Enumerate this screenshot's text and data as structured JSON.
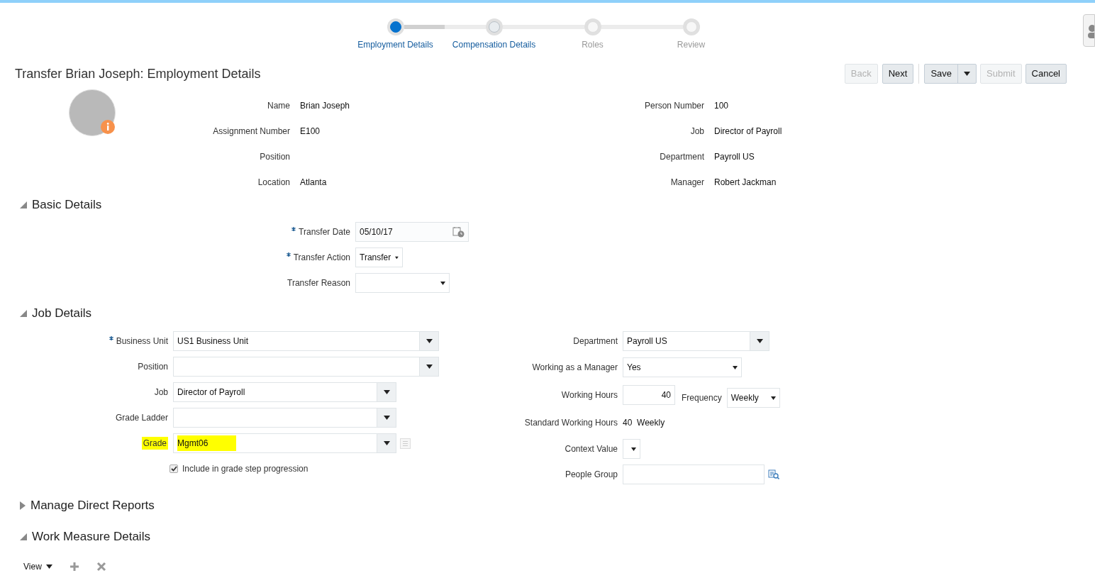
{
  "train": [
    {
      "label": "Employment Details",
      "selected": true,
      "visited": true
    },
    {
      "label": "Compensation Details",
      "selected": false,
      "visited": true
    },
    {
      "label": "Roles",
      "selected": false,
      "visited": false
    },
    {
      "label": "Review",
      "selected": false,
      "visited": false
    }
  ],
  "title": "Transfer Brian Joseph: Employment Details",
  "navigation_buttons": [
    {
      "label": "Back",
      "kind": "button",
      "disabled": true
    },
    {
      "label": "Next",
      "kind": "button",
      "disabled": false
    }
  ],
  "action_buttons": [
    {
      "label": "Save",
      "kind": "split",
      "disabled": false
    },
    {
      "label": "Submit",
      "kind": "button",
      "disabled": true
    },
    {
      "label": "Cancel",
      "kind": "button",
      "disabled": false
    }
  ],
  "person": {
    "left": [
      {
        "label": "Name",
        "value": "Brian Joseph"
      },
      {
        "label": "Assignment Number",
        "value": "E100"
      },
      {
        "label": "Position"
      },
      {
        "label": "Location",
        "value": "Atlanta"
      }
    ],
    "right": [
      {
        "label": "Person Number",
        "value": "100"
      },
      {
        "label": "Job",
        "value": "Director of Payroll"
      },
      {
        "label": "Department",
        "value": "Payroll US"
      },
      {
        "label": "Manager",
        "value": "Robert Jackman"
      }
    ]
  },
  "sections": [
    {
      "title": "Basic Details",
      "expanded": true,
      "kind": "form",
      "fields": [
        {
          "label": "Transfer Date",
          "kind": "date",
          "value": "05/10/17",
          "required": true
        },
        {
          "label": "Transfer Action",
          "kind": "choice",
          "value": "Transfer",
          "required": true
        },
        {
          "label": "Transfer Reason",
          "kind": "choice",
          "required": false
        }
      ]
    },
    {
      "title": "Job Details",
      "expanded": true,
      "kind": "two_column",
      "left": [
        {
          "label": "Business Unit",
          "kind": "lov",
          "value": "US1 Business Unit",
          "required": true,
          "highlighted": false,
          "detail_button": false
        },
        {
          "label": "Position",
          "kind": "lov",
          "required": false,
          "highlighted": false,
          "detail_button": false
        },
        {
          "label": "Job",
          "kind": "lov",
          "value": "Director of Payroll",
          "required": false,
          "highlighted": false,
          "detail_button": false
        },
        {
          "label": "Grade Ladder",
          "kind": "lov",
          "required": false,
          "highlighted": false,
          "detail_button": false
        },
        {
          "label": "Grade",
          "kind": "lov",
          "value": "Mgmt06",
          "required": false,
          "highlighted": true,
          "detail_button": true
        },
        {
          "label": "Include in grade step progression",
          "kind": "checkbox",
          "checked": true
        }
      ],
      "right": [
        {
          "label": "Department",
          "kind": "lov",
          "value": "Payroll US"
        },
        {
          "label": "Working as a Manager",
          "kind": "choice",
          "value": "Yes"
        },
        {
          "label": "Working Hours",
          "kind": "number",
          "value": "40",
          "extra": {
            "label": "Frequency",
            "value": "Weekly"
          }
        },
        {
          "label": "Standard Working Hours",
          "kind": "text",
          "value": "40  Weekly"
        },
        {
          "label": "Context Value",
          "kind": "choice"
        },
        {
          "label": "People Group",
          "kind": "search"
        }
      ]
    },
    {
      "title": "Manage Direct Reports",
      "expanded": false
    },
    {
      "title": "Work Measure Details",
      "expanded": true,
      "kind": "table",
      "toolbar": {
        "view_label": "View"
      }
    }
  ]
}
